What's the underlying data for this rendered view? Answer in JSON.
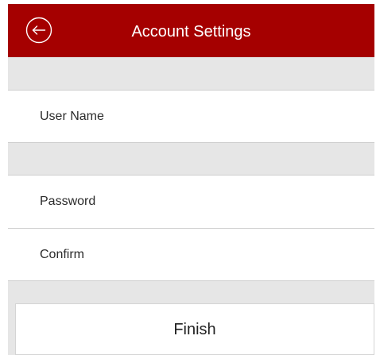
{
  "header": {
    "title": "Account Settings",
    "back_icon": "back-arrow-circle-icon",
    "background_color": "#a50000"
  },
  "form": {
    "user_name_label": "User Name",
    "password_label": "Password",
    "confirm_label": "Confirm"
  },
  "actions": {
    "finish_label": "Finish"
  }
}
